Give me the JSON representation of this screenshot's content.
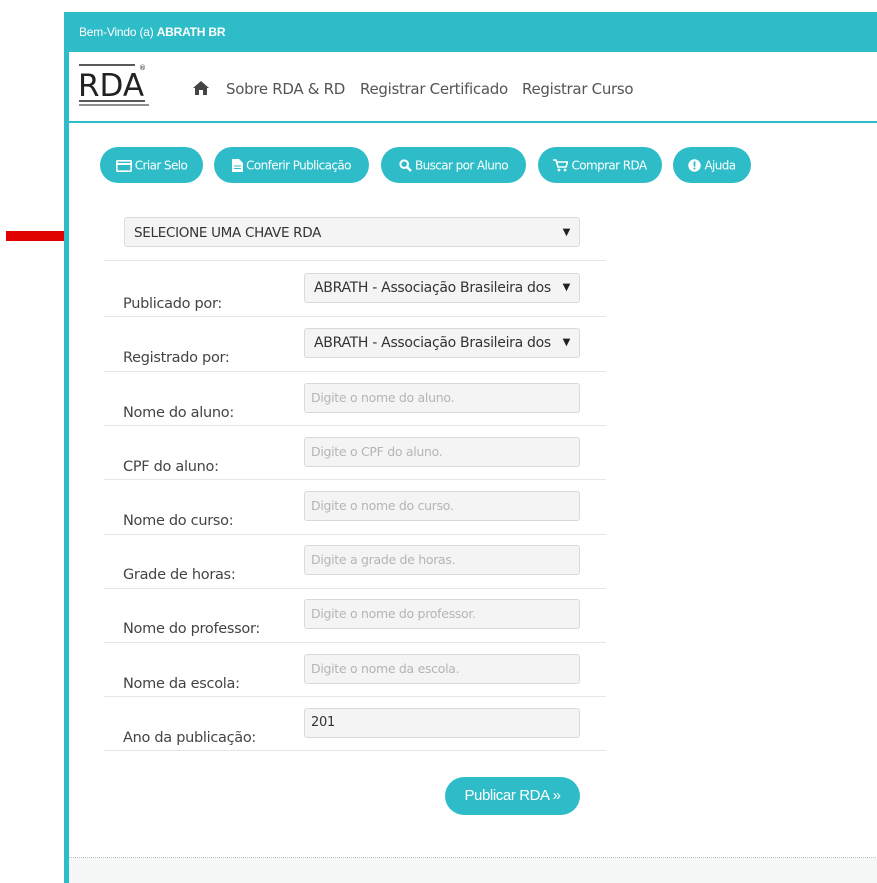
{
  "welcome": {
    "prefix": "Bem-Vindo (a)",
    "user": "ABRATH BR"
  },
  "logo": {
    "text": "RDA",
    "mark": "®"
  },
  "nav": {
    "items": [
      "Sobre RDA & RD",
      "Registrar Certificado",
      "Registrar Curso"
    ]
  },
  "actions": {
    "criar_selo": "Criar Selo",
    "conferir": "Conferir Publicação",
    "buscar": "Buscar por Aluno",
    "comprar": "Comprar RDA",
    "ajuda": "Ajuda"
  },
  "rda_key": {
    "selected": "SELECIONE UMA CHAVE RDA"
  },
  "form": {
    "publicado_label": "Publicado por:",
    "publicado_value": "ABRATH - Associação Brasileira dos",
    "registrado_label": "Registrado por:",
    "registrado_value": "ABRATH - Associação Brasileira dos",
    "nome_aluno_label": "Nome do aluno:",
    "nome_aluno_ph": "Digite o nome do aluno.",
    "cpf_label": "CPF do aluno:",
    "cpf_ph": "Digite o CPF do aluno.",
    "curso_label": "Nome do curso:",
    "curso_ph": "Digite o nome do curso.",
    "grade_label": "Grade de horas:",
    "grade_ph": "Digite a grade de horas.",
    "professor_label": "Nome do professor:",
    "professor_ph": "Digite o nome do professor.",
    "escola_label": "Nome da escola:",
    "escola_ph": "Digite o nome da escola.",
    "ano_label": "Ano da publicação:",
    "ano_value": "201"
  },
  "submit": {
    "label": "Publicar RDA »"
  },
  "colors": {
    "accent": "#2dbcc8",
    "arrow": "#e00000"
  }
}
